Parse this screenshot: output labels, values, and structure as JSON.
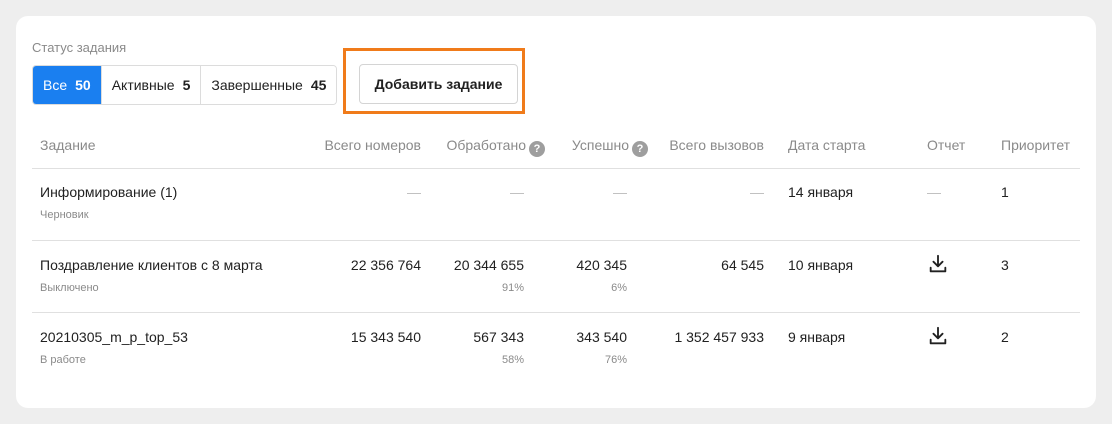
{
  "status_label": "Статус задания",
  "filters": [
    {
      "label": "Все",
      "count": "50"
    },
    {
      "label": "Активные",
      "count": "5"
    },
    {
      "label": "Завершенные",
      "count": "45"
    }
  ],
  "add_button": "Добавить задание",
  "columns": {
    "task": "Задание",
    "total_numbers": "Всего номеров",
    "processed": "Обработано",
    "success": "Успешно",
    "total_calls": "Всего вызовов",
    "start_date": "Дата старта",
    "report": "Отчет",
    "priority": "Приоритет",
    "help": "?"
  },
  "rows": [
    {
      "name": "Информирование (1)",
      "status": "Черновик",
      "total_numbers": "—",
      "processed": "—",
      "processed_pct": "",
      "success": "—",
      "success_pct": "",
      "total_calls": "—",
      "start_date": "14 января",
      "report": "—",
      "priority": "1"
    },
    {
      "name": "Поздравление клиентов с 8 марта",
      "status": "Выключено",
      "total_numbers": "22 356 764",
      "processed": "20 344 655",
      "processed_pct": "91%",
      "success": "420 345",
      "success_pct": "6%",
      "total_calls": "64 545",
      "start_date": "10 января",
      "report": "download-icon",
      "priority": "3"
    },
    {
      "name": "20210305_m_p_top_53",
      "status": "В работе",
      "total_numbers": "15 343 540",
      "processed": "567 343",
      "processed_pct": "58%",
      "success": "343 540",
      "success_pct": "76%",
      "total_calls": "1 352 457 933",
      "start_date": "9 января",
      "report": "download-icon",
      "priority": "2"
    }
  ],
  "colors": {
    "accent": "#1a7ff0",
    "highlight": "#f07b1a"
  }
}
